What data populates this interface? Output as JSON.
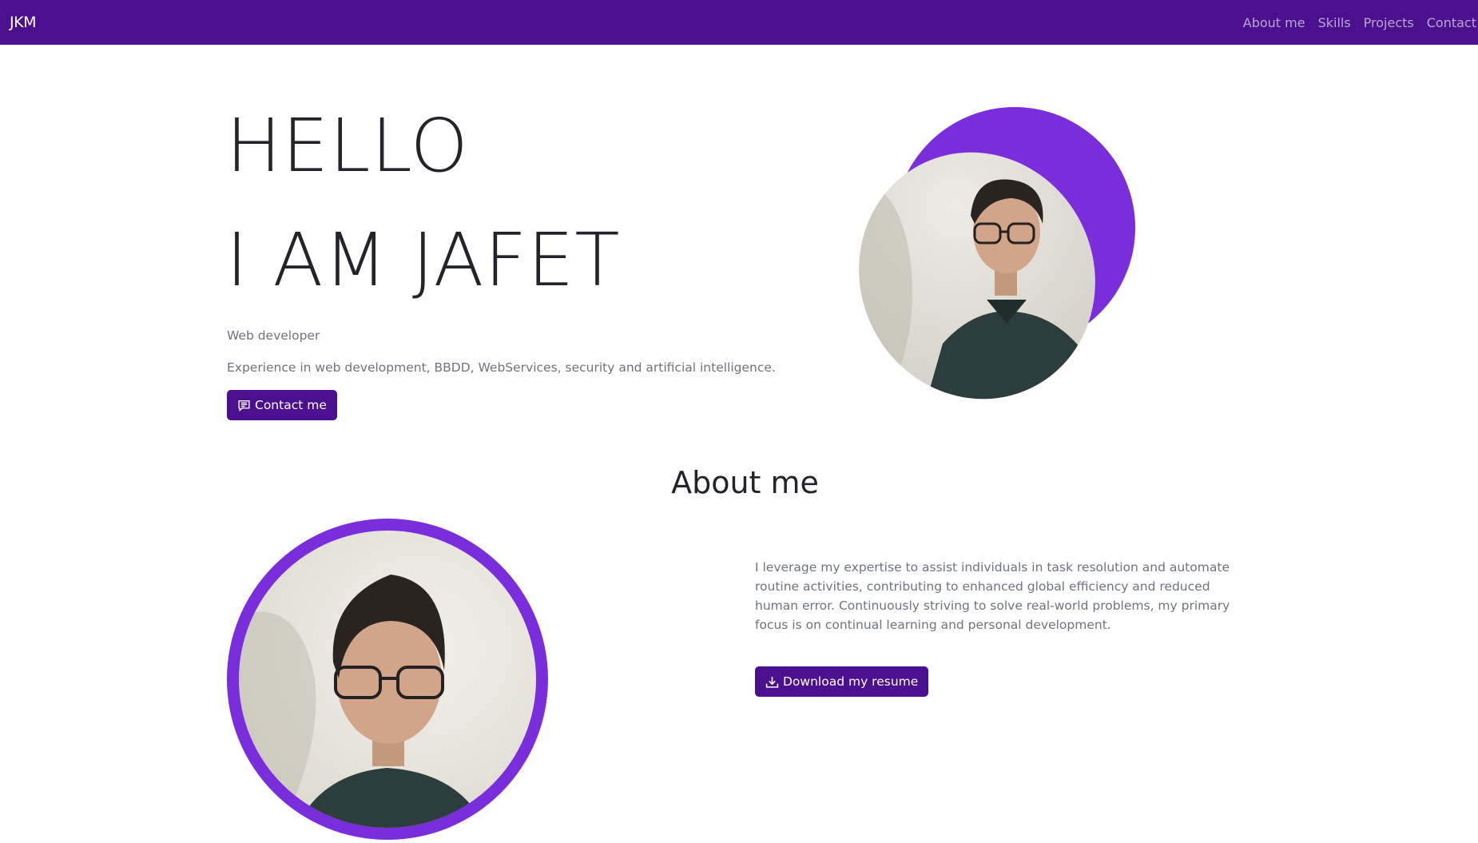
{
  "navbar": {
    "brand": "JKM",
    "links": [
      "About me",
      "Skills",
      "Projects",
      "Contact"
    ],
    "background": "#4a108d"
  },
  "hero": {
    "line1": "HELLO",
    "line2": "I AM JAFET",
    "subtitle": "Web developer",
    "description": "Experience in web development, BBDD, WebServices, security and artificial intelligence.",
    "contact_button": "Contact me",
    "contact_icon": "chat-icon"
  },
  "about": {
    "title": "About me",
    "paragraph": "I leverage my expertise to assist individuals in task resolution and automate routine activities, contributing to enhanced global efficiency and reduced human error. Continuously striving to solve real-world problems, my primary focus is on continual learning and personal development.",
    "download_button": "Download my resume",
    "download_icon": "download-icon"
  },
  "colors": {
    "accent": "#4a108d",
    "blob": "#7a2ddb",
    "text": "#212529",
    "muted": "#6c757d"
  }
}
